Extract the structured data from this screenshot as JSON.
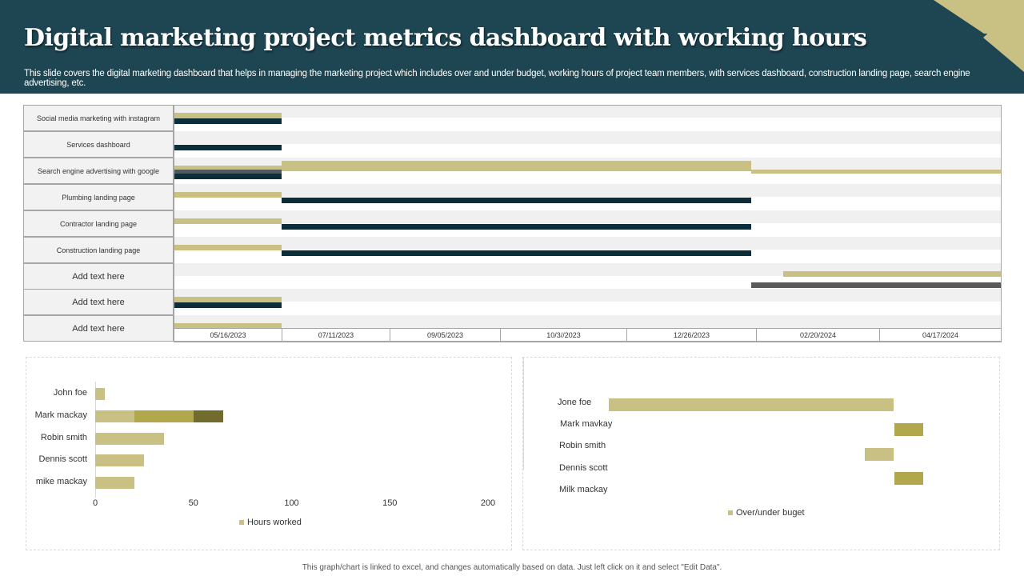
{
  "header": {
    "title": "Digital marketing project metrics dashboard with working hours",
    "subtitle": "This slide covers the digital marketing dashboard that helps in managing the marketing project which includes over and under budget, working hours of project team members, with services dashboard, construction  landing page, search engine advertising, etc."
  },
  "colors": {
    "header": "#1d4552",
    "gold": "#c9c084",
    "dark": "#0b2e3a",
    "slate": "#4d5b61",
    "gray": "#595959",
    "olive": "#b0a84a",
    "darkolive": "#716b2e"
  },
  "gantt": {
    "tasks": [
      {
        "label": "Social media marketing with  instagram",
        "big": false,
        "bars": [
          {
            "c": "gold",
            "from": 0,
            "to": 1,
            "lane": 0
          },
          {
            "c": "dark",
            "from": 0,
            "to": 1,
            "lane": 1
          }
        ]
      },
      {
        "label": "Services dashboard",
        "big": false,
        "bars": [
          {
            "c": "dark",
            "from": 0,
            "to": 1,
            "lane": 1
          }
        ]
      },
      {
        "label": "Search engine  advertising with google",
        "big": false,
        "bars": [
          {
            "c": "gold",
            "from": 0,
            "to": 1,
            "lane": 0
          },
          {
            "c": "slate",
            "from": 0,
            "to": 1,
            "lane": 1
          },
          {
            "c": "dark",
            "from": 0,
            "to": 1,
            "lane": 2
          },
          {
            "c": "gold",
            "from": 1,
            "to": 4.96,
            "lane": "thick"
          },
          {
            "c": "gold",
            "from": 4.96,
            "to": 7,
            "lane": 1
          }
        ]
      },
      {
        "label": "Plumbing landing  page",
        "big": false,
        "bars": [
          {
            "c": "gold",
            "from": 0,
            "to": 1,
            "lane": 0
          },
          {
            "c": "dark",
            "from": 1,
            "to": 4.96,
            "lane": 2
          }
        ]
      },
      {
        "label": "Contractor landing  page",
        "big": false,
        "bars": [
          {
            "c": "gold",
            "from": 0,
            "to": 1,
            "lane": 0
          },
          {
            "c": "dark",
            "from": 1,
            "to": 4.96,
            "lane": 2
          }
        ]
      },
      {
        "label": "Construction landing page",
        "big": false,
        "bars": [
          {
            "c": "gold",
            "from": 0,
            "to": 1,
            "lane": 0
          },
          {
            "c": "dark",
            "from": 1,
            "to": 4.96,
            "lane": 2
          }
        ]
      },
      {
        "label": "Add text here",
        "big": true,
        "bars": [
          {
            "c": "gold",
            "from": 5.22,
            "to": 7,
            "lane": 0
          },
          {
            "c": "gray",
            "from": 4.96,
            "to": 7,
            "lane": 3
          }
        ]
      },
      {
        "label": "Add text here",
        "big": true,
        "bars": [
          {
            "c": "gold",
            "from": 0,
            "to": 1,
            "lane": 0
          },
          {
            "c": "dark",
            "from": 0,
            "to": 1,
            "lane": 1
          }
        ]
      },
      {
        "label": "Add text here",
        "big": true,
        "bars": [
          {
            "c": "gold",
            "from": 0,
            "to": 1,
            "lane": 0
          }
        ]
      }
    ],
    "dates": [
      "05/16/2023",
      "07/11/2023",
      "09/05/2023",
      "10/3//2023",
      "12/26/2023",
      "02/20/2024",
      "04/17/2024"
    ]
  },
  "chart_data": [
    {
      "type": "bar",
      "orientation": "horizontal",
      "title": "",
      "categories": [
        "John foe",
        "Mark mackay",
        "Robin smith",
        "Dennis scott",
        "mike mackay"
      ],
      "segments": [
        [
          5
        ],
        [
          20,
          30,
          15
        ],
        [
          35
        ],
        [
          25
        ],
        [
          20
        ]
      ],
      "xlim": [
        0,
        200
      ],
      "xticks": [
        "0",
        "50",
        "100",
        "150",
        "200"
      ],
      "legend": "Hours worked",
      "legend_position": "bottom"
    },
    {
      "type": "bar",
      "orientation": "horizontal",
      "title": "",
      "categories": [
        "Jone foe",
        "Mark mavkay",
        "Robin smith",
        "Dennis scott",
        "Milk mackay"
      ],
      "values": [
        -100,
        10,
        -10,
        10,
        0
      ],
      "legend": "Over/under buget",
      "legend_position": "bottom"
    }
  ],
  "footer": "This graph/chart is linked to excel, and changes automatically based on data. Just left click on it and select \"Edit Data\"."
}
